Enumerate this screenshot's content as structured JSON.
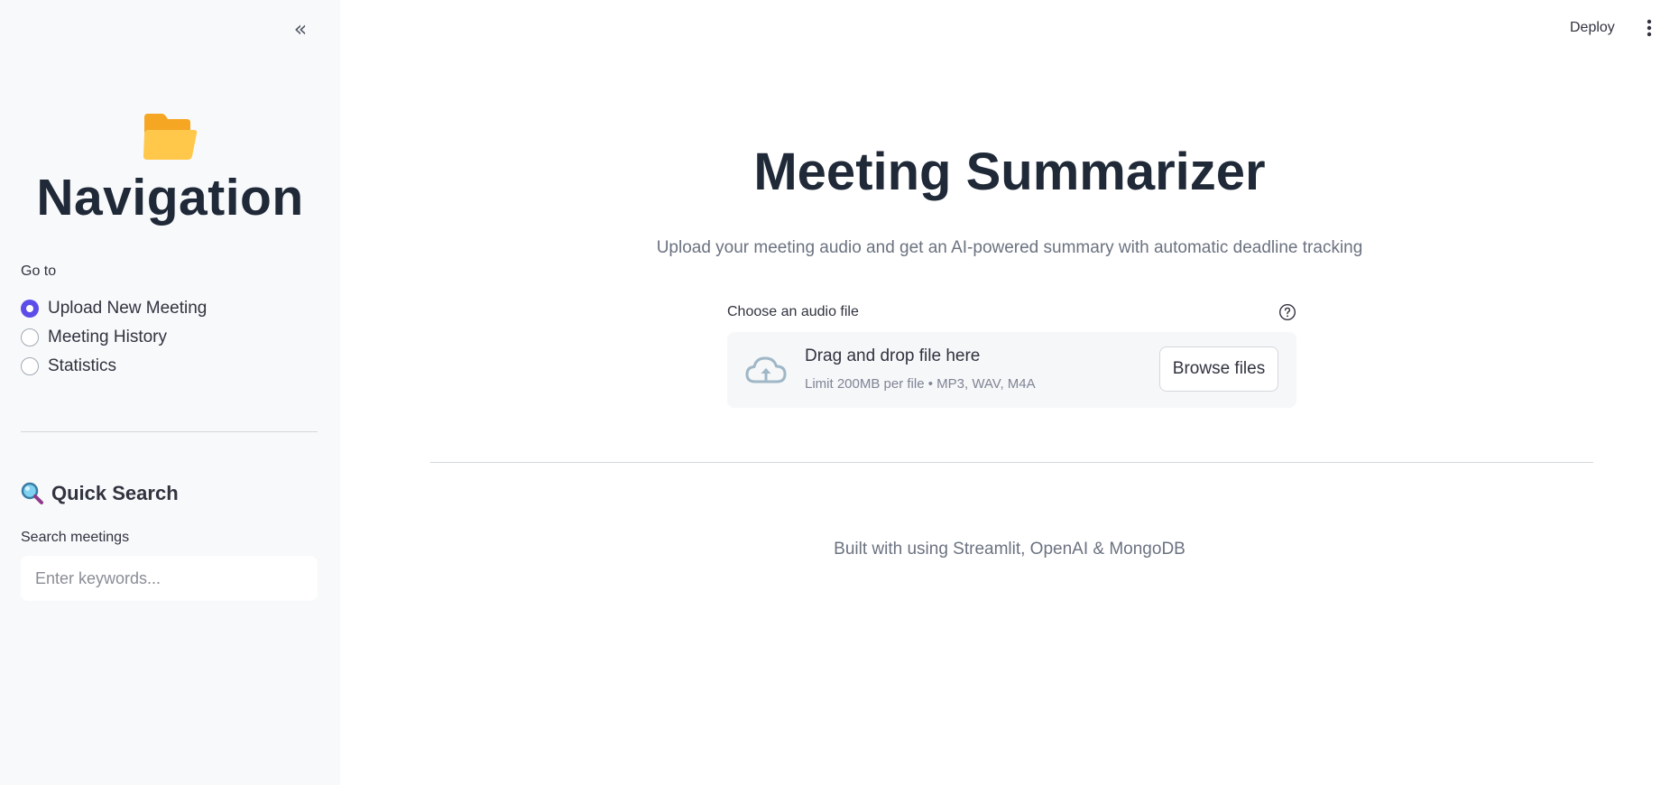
{
  "sidebar": {
    "collapse_glyph": "«",
    "folder_icon": "open-folder-icon",
    "title": "Navigation",
    "goto_label": "Go to",
    "options": [
      {
        "label": "Upload New Meeting",
        "selected": true
      },
      {
        "label": "Meeting History",
        "selected": false
      },
      {
        "label": "Statistics",
        "selected": false
      }
    ],
    "quick_search": {
      "icon": "magnifier-icon",
      "title": "Quick Search",
      "input_label": "Search meetings",
      "placeholder": "Enter keywords..."
    }
  },
  "header": {
    "deploy_label": "Deploy",
    "menu_icon": "vertical-dots-icon"
  },
  "main": {
    "title": "Meeting Summarizer",
    "subtitle": "Upload your meeting audio and get an AI-powered summary with automatic deadline tracking",
    "uploader": {
      "label": "Choose an audio file",
      "help_icon": "question-circle-icon",
      "drop_title": "Drag and drop file here",
      "drop_limit": "Limit 200MB per file • MP3, WAV, M4A",
      "browse_label": "Browse files"
    },
    "footer": "Built with using Streamlit, OpenAI & MongoDB"
  },
  "colors": {
    "accent": "#5b4ee8",
    "sidebar_bg": "#f8f9fb",
    "heading": "#1f2937",
    "muted_text": "#6b7280"
  }
}
